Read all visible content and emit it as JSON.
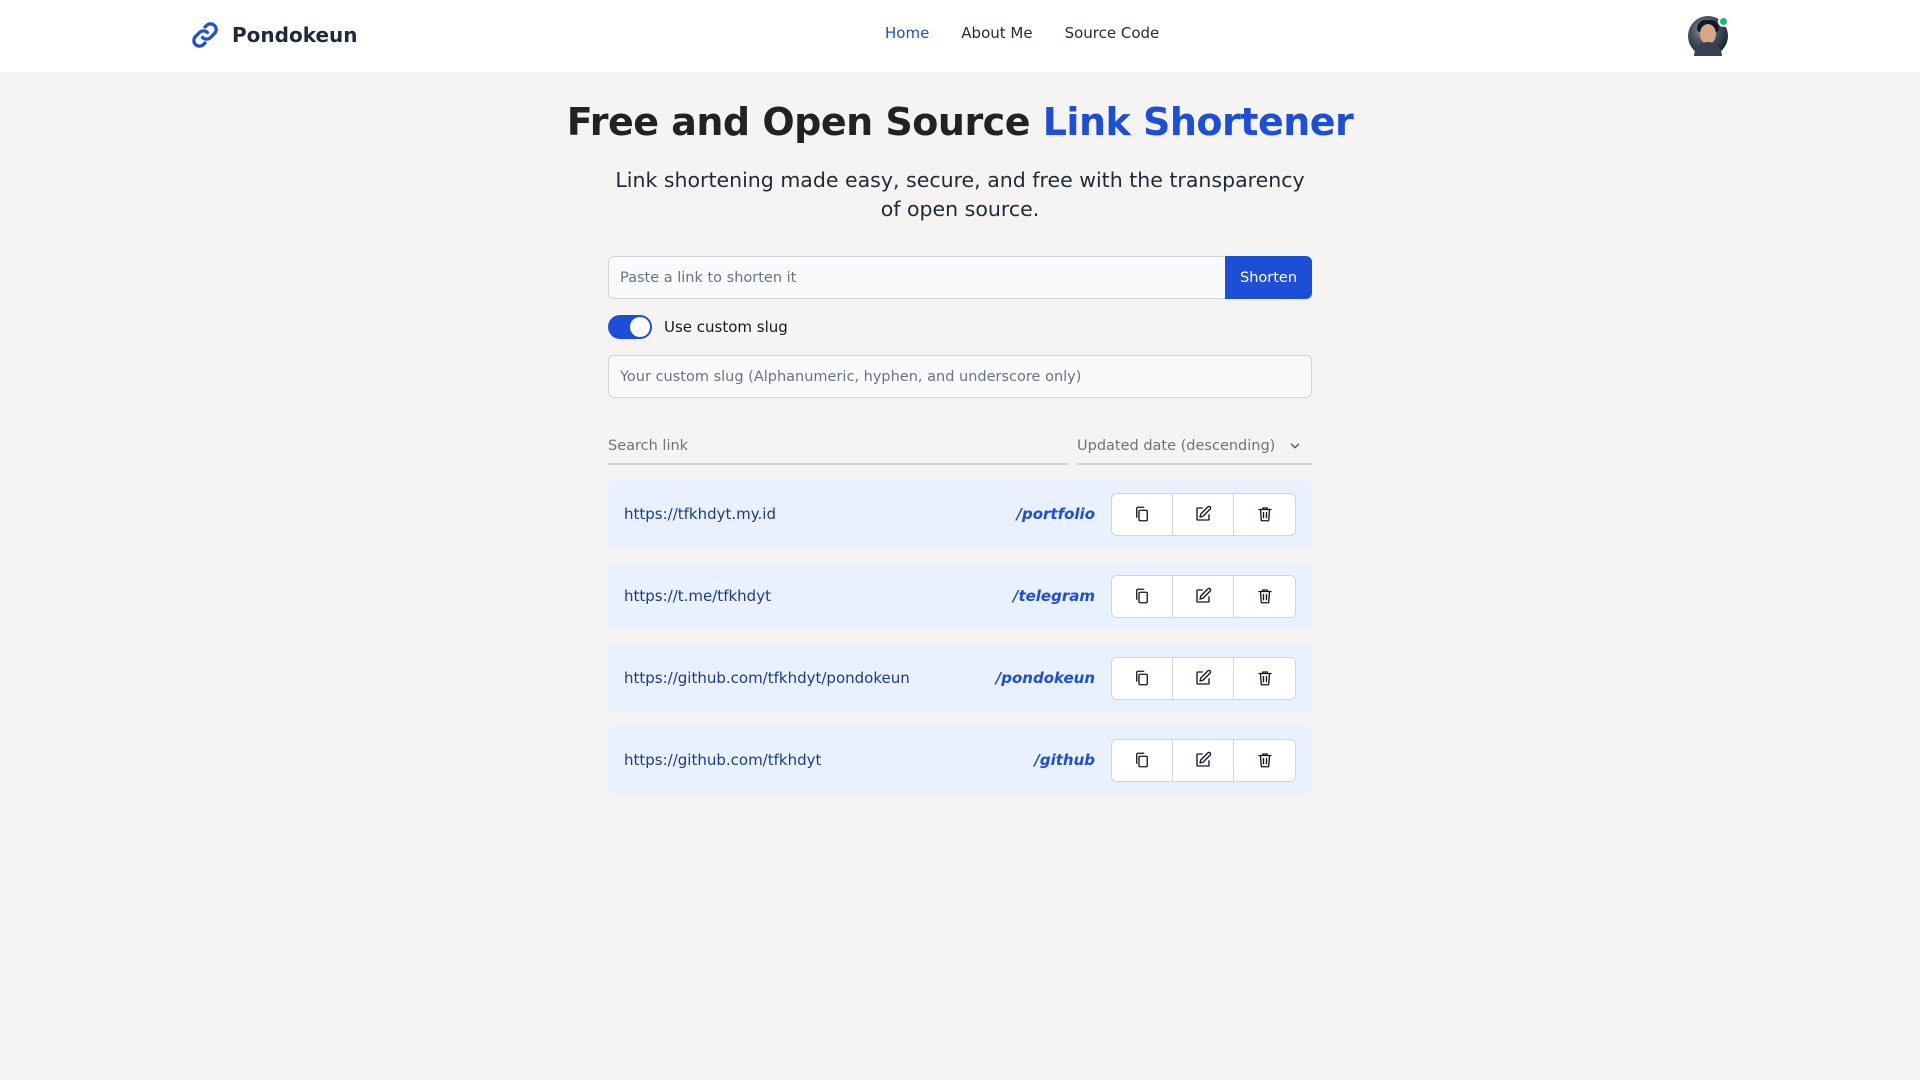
{
  "nav": {
    "brand": "Pondokeun",
    "links": [
      {
        "label": "Home",
        "active": true
      },
      {
        "label": "About Me",
        "active": false
      },
      {
        "label": "Source Code",
        "active": false
      }
    ]
  },
  "hero": {
    "title_prefix": "Free and Open Source ",
    "title_accent": "Link Shortener",
    "subtitle": "Link shortening made easy, secure, and free with the transparency of open source."
  },
  "shorten": {
    "link_placeholder": "Paste a link to shorten it",
    "button_label": "Shorten",
    "custom_slug_label": "Use custom slug",
    "custom_slug_enabled": true,
    "slug_placeholder": "Your custom slug (Alphanumeric, hyphen, and underscore only)"
  },
  "filters": {
    "search_placeholder": "Search link",
    "sort_selected": "Updated date (descending)"
  },
  "links": [
    {
      "url": "https://tfkhdyt.my.id",
      "slug": "/portfolio"
    },
    {
      "url": "https://t.me/tfkhdyt",
      "slug": "/telegram"
    },
    {
      "url": "https://github.com/tfkhdyt/pondokeun",
      "slug": "/pondokeun"
    },
    {
      "url": "https://github.com/tfkhdyt",
      "slug": "/github"
    }
  ],
  "colors": {
    "accent": "#1d4ed8",
    "background": "#f5f4f3",
    "card": "#e8f1fd",
    "status_online": "#10b981"
  },
  "icons": [
    "link-icon",
    "chevron-down-icon",
    "copy-icon",
    "edit-icon",
    "trash-icon"
  ]
}
